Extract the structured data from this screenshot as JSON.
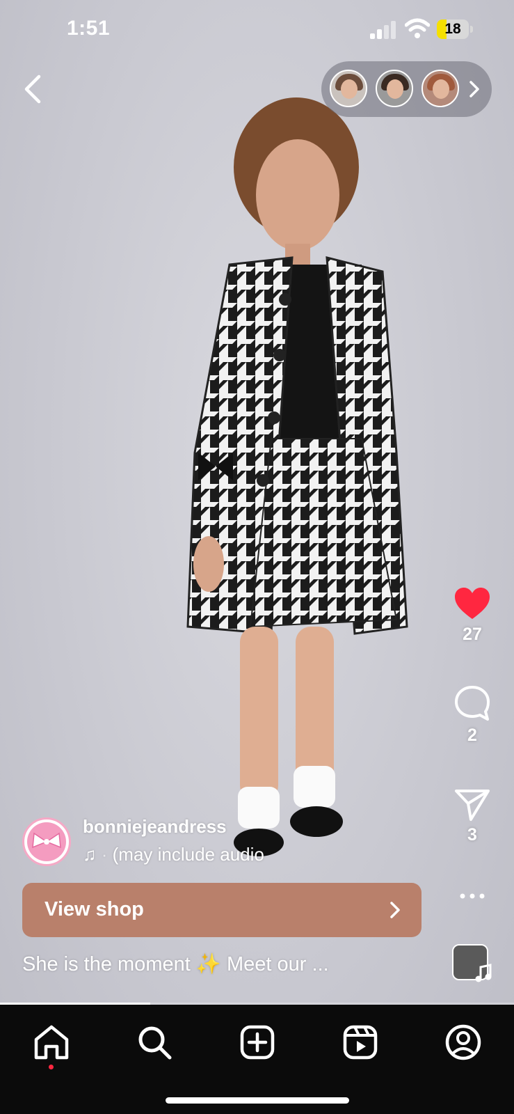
{
  "status": {
    "time": "1:51",
    "battery": "18"
  },
  "nav_top": {
    "back_icon": "chevron-left-icon"
  },
  "post": {
    "author": "bonniejeandress",
    "audio_prefix": "♫",
    "audio_text": "(may include audio",
    "shop_label": "View shop",
    "caption": "She is the moment ✨  Meet our ..."
  },
  "actions": {
    "likes": "27",
    "comments": "2",
    "shares": "3"
  },
  "colors": {
    "like": "#ff2740",
    "shop_button": "#b9806b",
    "nav_bg": "#0b0b0b"
  },
  "bottom_nav": [
    "home-icon",
    "search-icon",
    "create-icon",
    "reels-icon",
    "profile-icon"
  ]
}
